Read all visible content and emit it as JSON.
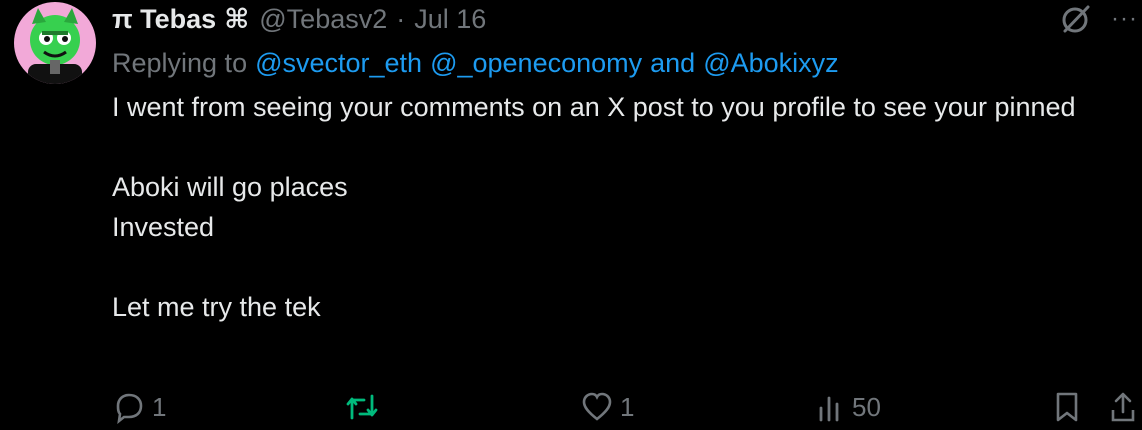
{
  "tweet": {
    "display_name": "π Tebas",
    "name_symbol": "⌘",
    "handle": "@Tebasv2",
    "separator": "·",
    "date": "Jul 16",
    "replying_label": "Replying to",
    "mentions": [
      "@svector_eth",
      "@_openeconomy",
      "and",
      "@Abokixyz"
    ],
    "body_lines": [
      "I went from seeing your comments on an X post to you profile to see your pinned",
      "",
      "Aboki will go places",
      "Invested",
      "",
      "Let me try the tek"
    ],
    "more_label": "···"
  },
  "actions": {
    "replies": "1",
    "reposts": "",
    "likes": "1",
    "views": "50"
  },
  "colors": {
    "background": "#000000",
    "text": "#e7e9ea",
    "muted": "#71767b",
    "link": "#1d9bf0",
    "repost_active": "#00ba7c",
    "avatar_bg": "#f2a9d8",
    "avatar_face": "#37d04f"
  },
  "icons": [
    "avatar",
    "grok-icon",
    "more-icon",
    "reply-icon",
    "repost-icon",
    "like-icon",
    "views-icon",
    "bookmark-icon",
    "share-icon"
  ]
}
